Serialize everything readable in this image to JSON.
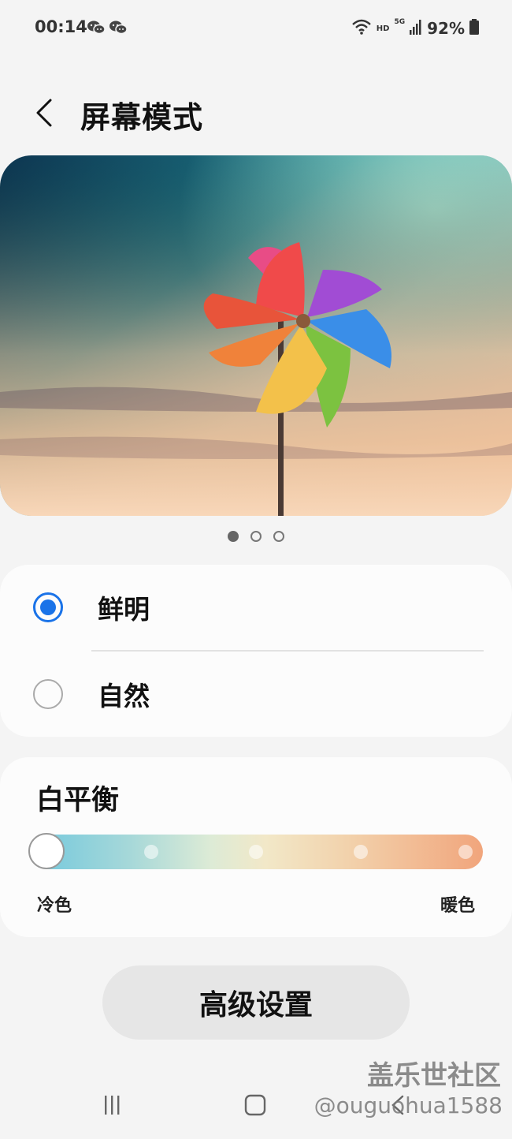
{
  "status_bar": {
    "time": "00:14",
    "notification_icons": [
      "wechat-icon",
      "wechat-icon"
    ],
    "hd_label": "HD",
    "network_label": "5G",
    "battery_percent": "92%",
    "right_icons": [
      "wifi-icon",
      "signal-icon",
      "battery-icon"
    ]
  },
  "header": {
    "back_icon": "chevron-left-icon",
    "title": "屏幕模式"
  },
  "preview": {
    "image": "pinwheel-photo",
    "page_count": 3,
    "active_page": 1
  },
  "screen_modes": {
    "options": [
      {
        "label": "鲜明",
        "selected": true
      },
      {
        "label": "自然",
        "selected": false
      }
    ],
    "accent_color": "#1a73e8"
  },
  "white_balance": {
    "title": "白平衡",
    "cold_label": "冷色",
    "warm_label": "暖色",
    "steps": 5,
    "current_step": 1,
    "gradient_colors": [
      "#72c8dd",
      "#f2e8c8",
      "#f1a57c"
    ]
  },
  "advanced_button": {
    "label": "高级设置"
  },
  "nav_bar": {
    "items": [
      "recents-icon",
      "home-icon",
      "back-icon"
    ]
  },
  "watermark": {
    "line1": "盖乐世社区",
    "line2": "@ouguohua1588"
  }
}
